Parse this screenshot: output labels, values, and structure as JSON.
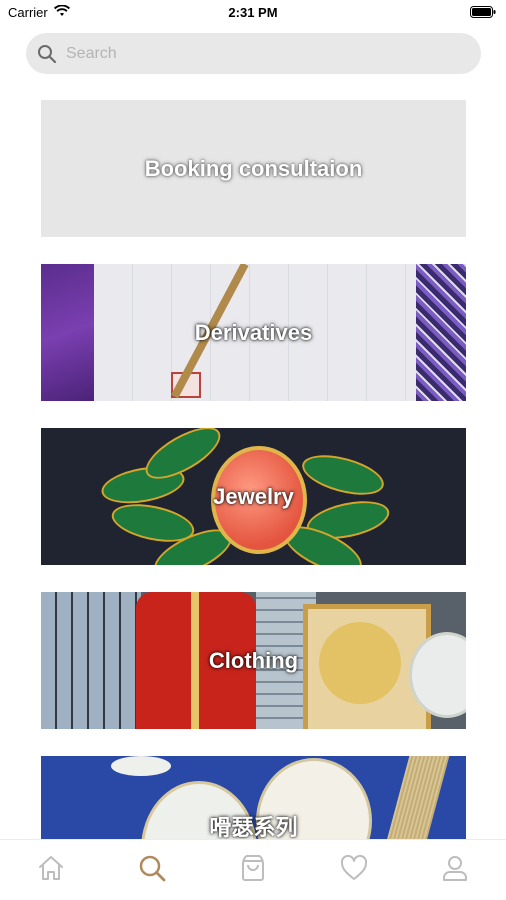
{
  "status_bar": {
    "carrier": "Carrier",
    "time": "2:31 PM"
  },
  "search": {
    "placeholder": "Search",
    "value": ""
  },
  "categories": [
    {
      "label": "Booking consultaion",
      "icon": "none"
    },
    {
      "label": "Derivatives"
    },
    {
      "label": "Jewelry"
    },
    {
      "label": "Clothing"
    },
    {
      "label": "嗗瑟系列"
    }
  ],
  "tab_bar": {
    "items": [
      {
        "icon": "home-icon",
        "active": false
      },
      {
        "icon": "search-icon",
        "active": true
      },
      {
        "icon": "shopping-bag-icon",
        "active": false
      },
      {
        "icon": "heart-icon",
        "active": false
      },
      {
        "icon": "profile-icon",
        "active": false
      }
    ],
    "active_color": "#b08a5a",
    "inactive_color": "#bdbdbd"
  }
}
